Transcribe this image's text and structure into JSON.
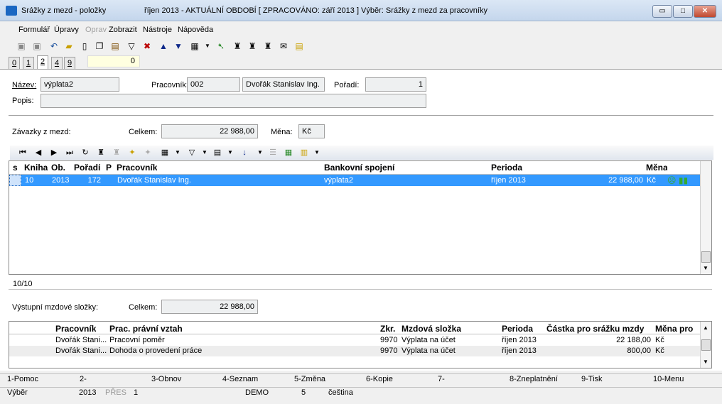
{
  "window": {
    "title_left": "Srážky z mezd - položky",
    "title_right": "říjen 2013 - AKTUÁLNÍ OBDOBÍ [ ZPRACOVÁNO: září 2013 ] Výběr: Srážky z mezd za pracovníky",
    "minimize": "▭",
    "maximize": "□",
    "close": "✕"
  },
  "menu": [
    "Formulář",
    "Úpravy",
    "Oprav",
    "Zobrazit",
    "Nástroje",
    "Nápověda"
  ],
  "toolbar_icons": [
    "save-icon",
    "save-as-icon",
    "undo-icon",
    "open-folder-icon",
    "new-document-icon",
    "copy-icon",
    "book-icon",
    "filter-icon",
    "delete-icon",
    "arrow-up-icon",
    "arrow-down-icon",
    "print-icon",
    "dropdown-icon",
    "export-icon",
    "binoculars-icon",
    "find-next-icon",
    "find-prev-icon",
    "mail-icon",
    "notes-icon"
  ],
  "tabs": [
    "0",
    "1",
    "2",
    "4",
    "9"
  ],
  "tab_counter": "0",
  "form": {
    "nazev_label": "Název:",
    "nazev_value": "výplata2",
    "pracovnik_label": "Pracovník:",
    "pracovnik_code": "002",
    "pracovnik_name": "Dvořák Stanislav Ing.",
    "poradi_label": "Pořadí:",
    "poradi_value": "1",
    "popis_label": "Popis:",
    "popis_value": "",
    "zavazky_label": "Závazky z mezd:",
    "celkem_label": "Celkem:",
    "celkem_value": "22 988,00",
    "mena_label": "Měna:",
    "mena_value": "Kč"
  },
  "grid1": {
    "headers": [
      "s",
      "Kniha",
      "Ob.",
      "Pořadí",
      "P",
      "Pracovník",
      "Bankovní spojení",
      "Perioda",
      "",
      "Měna"
    ],
    "rows": [
      [
        "",
        "10",
        "2013",
        "172",
        "",
        "Dvořák Stanislav Ing.",
        "výplata2",
        "říjen 2013",
        "22 988,00",
        "Kč"
      ]
    ],
    "count": "10/10"
  },
  "vystupni": {
    "label": "Výstupní mzdové složky:",
    "celkem_label": "Celkem:",
    "celkem_value": "22 988,00"
  },
  "grid2": {
    "headers": [
      "Pracovník",
      "Prac. právní vztah",
      "Zkr.",
      "Mzdová složka",
      "Perioda",
      "Částka pro srážku mzdy",
      "Měna pro"
    ],
    "rows": [
      [
        "Dvořák Stani...",
        "Pracovní poměr",
        "9970",
        "Výplata na účet",
        "říjen 2013",
        "22 188,00",
        "Kč"
      ],
      [
        "Dvořák Stani...",
        "Dohoda o provedení práce",
        "9970",
        "Výplata na účet",
        "říjen 2013",
        "800,00",
        "Kč"
      ]
    ]
  },
  "fkeys": [
    "1-Pomoc",
    "2-",
    "3-Obnov",
    "4-Seznam",
    "5-Změna",
    "6-Kopie",
    "7-",
    "8-Zneplatnění",
    "9-Tisk",
    "10-Menu"
  ],
  "status": [
    "Výběr",
    "2013",
    "PŘES",
    "1",
    "DEMO",
    "5",
    "čeština"
  ]
}
